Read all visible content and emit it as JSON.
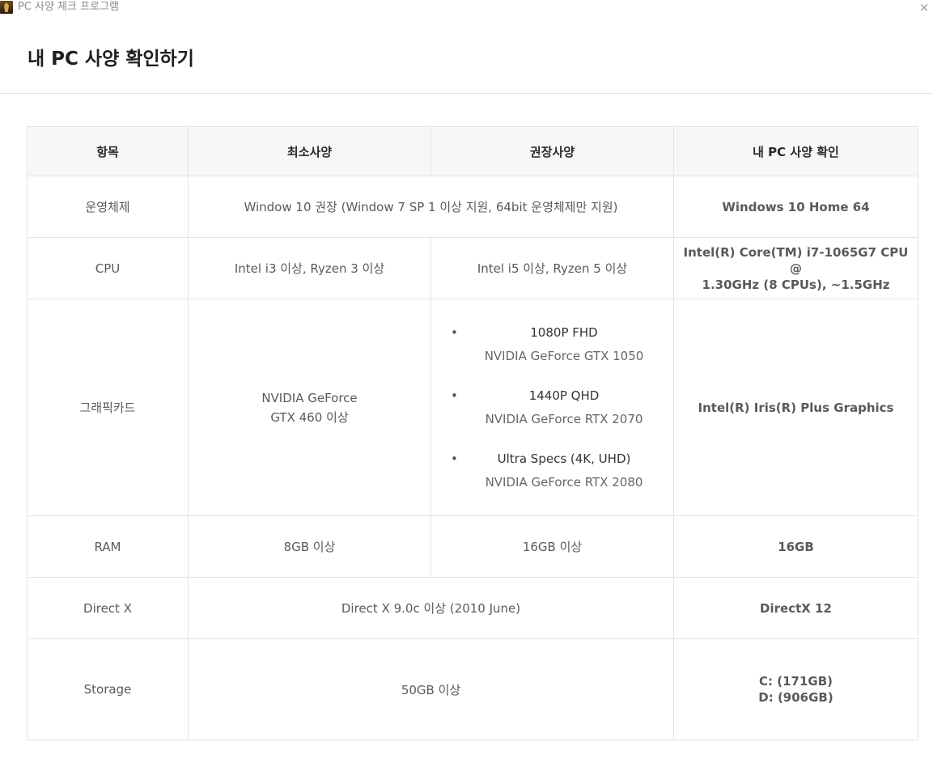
{
  "window": {
    "title": "PC 사양 체크 프로그램",
    "close_glyph": "×"
  },
  "page": {
    "title": "내 PC 사양 확인하기"
  },
  "table": {
    "headers": {
      "item": "항목",
      "minimum": "최소사양",
      "recommended": "권장사양",
      "mine": "내 PC 사양 확인"
    },
    "rows": {
      "os": {
        "item": "운영체제",
        "requirement": "Window 10 권장 (Window 7 SP 1 이상 지원, 64bit 운영체제만 지원)",
        "mine": "Windows 10 Home 64"
      },
      "cpu": {
        "item": "CPU",
        "minimum": "Intel i3 이상, Ryzen 3 이상",
        "recommended": "Intel i5 이상, Ryzen 5 이상",
        "mine_line1": "Intel(R) Core(TM) i7-1065G7 CPU @",
        "mine_line2": "1.30GHz (8 CPUs), ~1.5GHz"
      },
      "gpu": {
        "item": "그래픽카드",
        "minimum_line1": "NVIDIA GeForce",
        "minimum_line2": "GTX 460 이상",
        "recommended": [
          {
            "title": "1080P FHD",
            "card": "NVIDIA GeForce GTX 1050"
          },
          {
            "title": "1440P QHD",
            "card": "NVIDIA GeForce RTX 2070"
          },
          {
            "title": "Ultra Specs (4K, UHD)",
            "card": "NVIDIA GeForce RTX 2080"
          }
        ],
        "mine": "Intel(R) Iris(R) Plus Graphics"
      },
      "ram": {
        "item": "RAM",
        "minimum": "8GB 이상",
        "recommended": "16GB 이상",
        "mine": "16GB"
      },
      "directx": {
        "item": "Direct X",
        "requirement": "Direct X 9.0c 이상 (2010 June)",
        "mine": "DirectX 12"
      },
      "storage": {
        "item": "Storage",
        "requirement": "50GB 이상",
        "mine_line1": "C: (171GB)",
        "mine_line2": "D: (906GB)"
      }
    }
  },
  "colors": {
    "mine_text": "#7a6ce8",
    "header_bg": "#f7f7f7",
    "border": "#e4e4e4"
  }
}
